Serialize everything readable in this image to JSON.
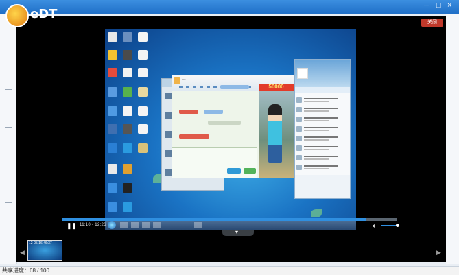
{
  "app": {
    "brand": "eDT",
    "window_controls": [
      "─",
      "□",
      "×"
    ]
  },
  "player": {
    "close_label": "关闭",
    "desktop_window_banner": "50000",
    "time_label": "11:10 - 12:26",
    "progress_fraction": 0.905,
    "volume_fraction": 0.95
  },
  "strip": {
    "thumbnail_label": "12-05 16:46:37"
  },
  "status": {
    "text": "共享进度：68 / 100"
  }
}
